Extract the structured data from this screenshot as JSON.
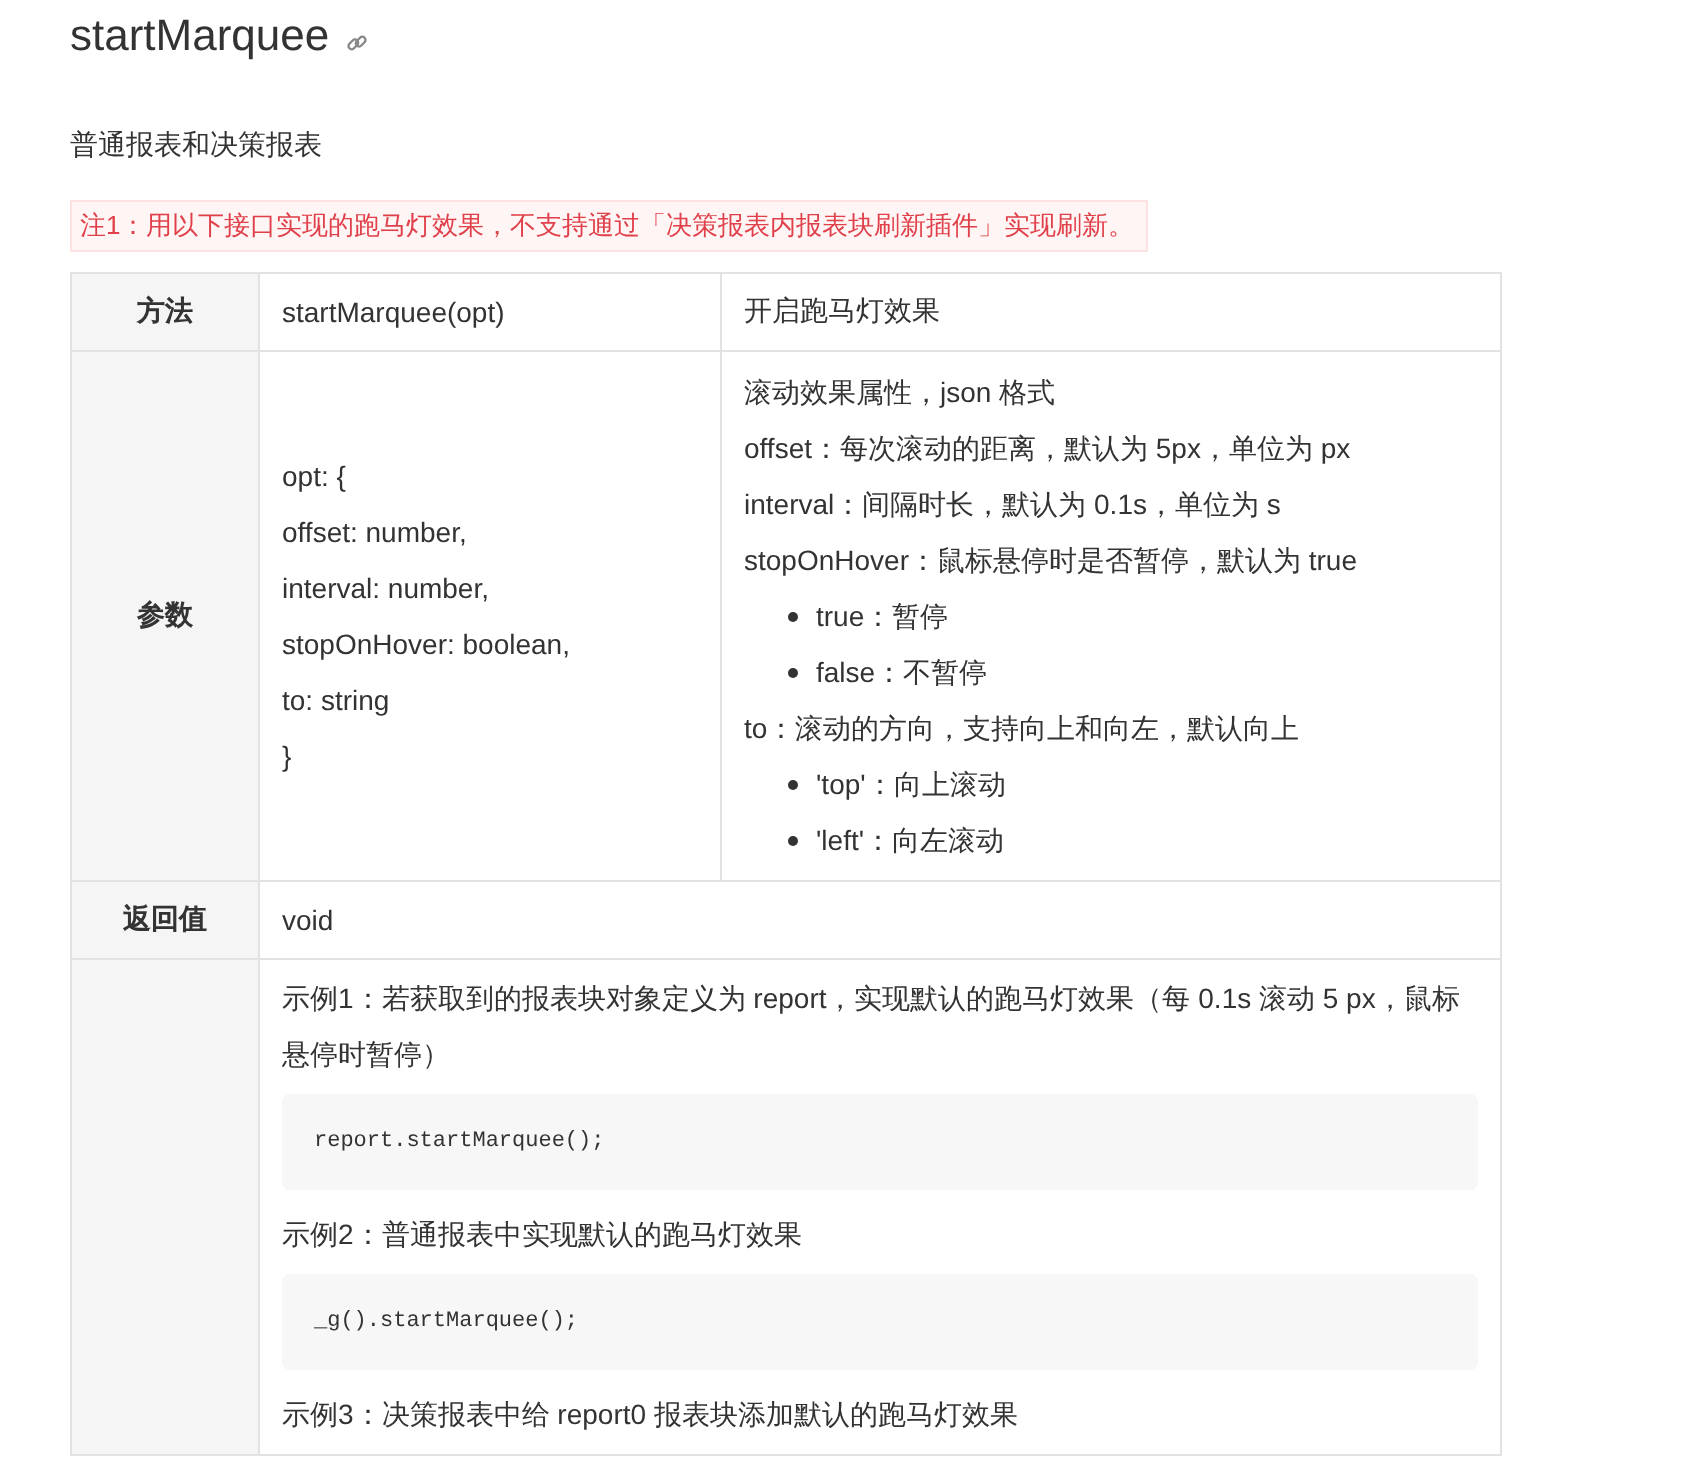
{
  "title": "startMarquee",
  "subtitle": "普通报表和决策报表",
  "note": "注1：用以下接口实现的跑马灯效果，不支持通过「决策报表内报表块刷新插件」实现刷新。",
  "table": {
    "rows": [
      {
        "kind": "plain",
        "header": "方法",
        "cells": [
          "startMarquee(opt)",
          "开启跑马灯效果"
        ]
      },
      {
        "kind": "params",
        "header": "参数",
        "code_lines": [
          "opt: {",
          "offset: number,",
          "interval: number,",
          "stopOnHover: boolean,",
          "to: string",
          "}"
        ],
        "description": [
          {
            "kind": "line",
            "text": "滚动效果属性，json 格式"
          },
          {
            "kind": "line",
            "text": "offset：每次滚动的距离，默认为 5px，单位为 px"
          },
          {
            "kind": "line",
            "text": "interval：间隔时长，默认为 0.1s，单位为 s"
          },
          {
            "kind": "line",
            "text": "stopOnHover：鼠标悬停时是否暂停，默认为 true"
          },
          {
            "kind": "bullet",
            "text": "true：暂停"
          },
          {
            "kind": "bullet",
            "text": "false：不暂停"
          },
          {
            "kind": "line",
            "text": "to：滚动的方向，支持向上和向左，默认向上"
          },
          {
            "kind": "bullet",
            "text": "'top'：向上滚动"
          },
          {
            "kind": "bullet",
            "text": "'left'：向左滚动"
          }
        ]
      },
      {
        "kind": "single",
        "header": "返回值",
        "value": "void"
      },
      {
        "kind": "examples",
        "items": [
          {
            "kind": "text",
            "text": "示例1：若获取到的报表块对象定义为 report，实现默认的跑马灯效果（每 0.1s 滚动 5 px，鼠标悬停时暂停）"
          },
          {
            "kind": "code",
            "text": "report.startMarquee();"
          },
          {
            "kind": "text",
            "text": "示例2：普通报表中实现默认的跑马灯效果"
          },
          {
            "kind": "code",
            "text": "_g().startMarquee();"
          },
          {
            "kind": "text",
            "text": "示例3：决策报表中给 report0 报表块添加默认的跑马灯效果"
          }
        ]
      }
    ]
  }
}
